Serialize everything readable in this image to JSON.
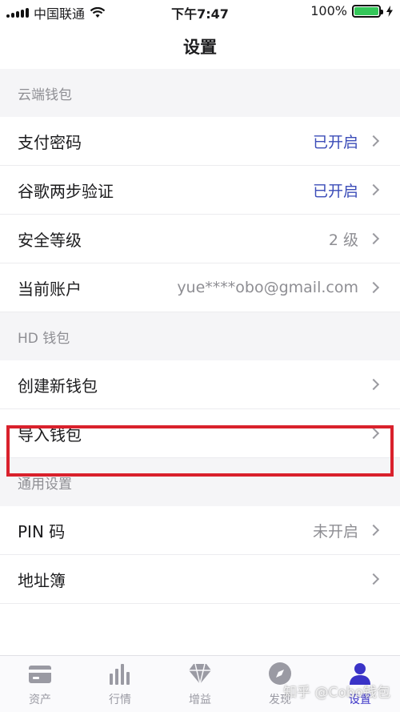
{
  "status_bar": {
    "carrier": "中国联通",
    "time": "下午7:47",
    "battery_percent": "100%",
    "battery_level": 1.0,
    "battery_color": "#34c759"
  },
  "nav": {
    "title": "设置"
  },
  "sections": [
    {
      "header": "云端钱包",
      "rows": [
        {
          "label": "支付密码",
          "value": "已开启",
          "state": "on"
        },
        {
          "label": "谷歌两步验证",
          "value": "已开启",
          "state": "on"
        },
        {
          "label": "安全等级",
          "value": "2 级",
          "state": "neutral"
        },
        {
          "label": "当前账户",
          "value": "yue****obo@gmail.com",
          "state": "neutral"
        }
      ]
    },
    {
      "header": "HD 钱包",
      "rows": [
        {
          "label": "创建新钱包",
          "value": "",
          "state": "neutral"
        },
        {
          "label": "导入钱包",
          "value": "",
          "state": "neutral",
          "highlighted": true
        }
      ]
    },
    {
      "header": "通用设置",
      "rows": [
        {
          "label": "PIN 码",
          "value": "未开启",
          "state": "off"
        },
        {
          "label": "地址簿",
          "value": "",
          "state": "neutral"
        }
      ]
    }
  ],
  "tabs": [
    {
      "label": "资产",
      "icon": "wallet-card-icon",
      "active": false
    },
    {
      "label": "行情",
      "icon": "bar-chart-icon",
      "active": false
    },
    {
      "label": "增益",
      "icon": "diamond-icon",
      "active": false
    },
    {
      "label": "发现",
      "icon": "compass-icon",
      "active": false
    },
    {
      "label": "设置",
      "icon": "user-icon",
      "active": true
    }
  ],
  "watermark": "知乎 @Cobo钱包",
  "colors": {
    "accent": "#3a33c7",
    "enabled_value": "#3b4cb8",
    "highlight_box": "#d9212c"
  }
}
